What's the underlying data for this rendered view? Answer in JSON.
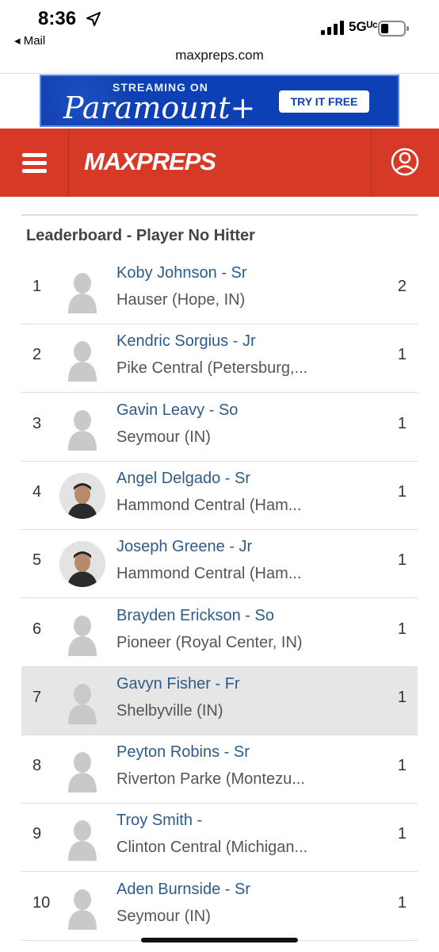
{
  "status": {
    "time": "8:36",
    "back_app": "◂ Mail",
    "network": "5Gᵁᶜ"
  },
  "browser": {
    "url": "maxpreps.com"
  },
  "ad": {
    "stream_text": "STREAMING ON",
    "brand": "Paramount+",
    "cta": "TRY IT FREE"
  },
  "header": {
    "logo": "MAXPREPS",
    "brand_color": "#d63a27"
  },
  "leaderboard": {
    "title": "Leaderboard - Player No Hitter",
    "rows": [
      {
        "rank": "1",
        "name": "Koby Johnson - Sr",
        "school": "Hauser (Hope, IN)",
        "value": "2",
        "avatar": "silhouette"
      },
      {
        "rank": "2",
        "name": "Kendric Sorgius - Jr",
        "school": "Pike Central (Petersburg,...",
        "value": "1",
        "avatar": "silhouette"
      },
      {
        "rank": "3",
        "name": "Gavin Leavy - So",
        "school": "Seymour (IN)",
        "value": "1",
        "avatar": "silhouette"
      },
      {
        "rank": "4",
        "name": "Angel Delgado - Sr",
        "school": "Hammond Central (Ham...",
        "value": "1",
        "avatar": "photo"
      },
      {
        "rank": "5",
        "name": "Joseph Greene - Jr",
        "school": "Hammond Central (Ham...",
        "value": "1",
        "avatar": "photo"
      },
      {
        "rank": "6",
        "name": "Brayden Erickson - So",
        "school": "Pioneer (Royal Center, IN)",
        "value": "1",
        "avatar": "silhouette"
      },
      {
        "rank": "7",
        "name": "Gavyn Fisher - Fr",
        "school": "Shelbyville (IN)",
        "value": "1",
        "avatar": "silhouette"
      },
      {
        "rank": "8",
        "name": "Peyton Robins - Sr",
        "school": "Riverton Parke (Montezu...",
        "value": "1",
        "avatar": "silhouette"
      },
      {
        "rank": "9",
        "name": "Troy Smith -",
        "school": "Clinton Central (Michigan...",
        "value": "1",
        "avatar": "silhouette"
      },
      {
        "rank": "10",
        "name": "Aden Burnside - Sr",
        "school": "Seymour (IN)",
        "value": "1",
        "avatar": "silhouette"
      }
    ]
  }
}
